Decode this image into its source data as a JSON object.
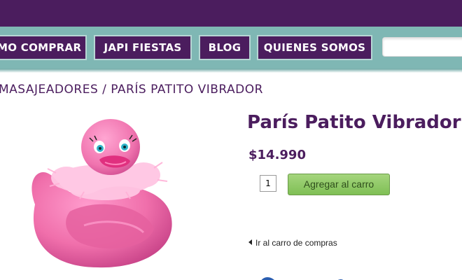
{
  "nav": {
    "items": [
      {
        "label": "MO COMPRAR"
      },
      {
        "label": "JAPI FIESTAS"
      },
      {
        "label": "BLOG"
      },
      {
        "label": "QUIENES SOMOS"
      }
    ]
  },
  "search": {
    "value": "",
    "placeholder": ""
  },
  "breadcrumb": "MASAJEADORES / PARÍS PATITO VIBRADOR",
  "product": {
    "title": "París Patito Vibrador",
    "price": "$14.990",
    "quantity": "1",
    "add_to_cart_label": "Agregar al carro",
    "image_icon": "pink-rubber-duck-with-feather-boa"
  },
  "cart_link": {
    "label": "Ir al carro de compras",
    "icon": "arrow-left-icon"
  },
  "colors": {
    "brand_purple": "#4b1d5e",
    "nav_teal": "#7fb7b4",
    "button_green": "#8cc763",
    "duck_pink": "#f07bb0"
  }
}
